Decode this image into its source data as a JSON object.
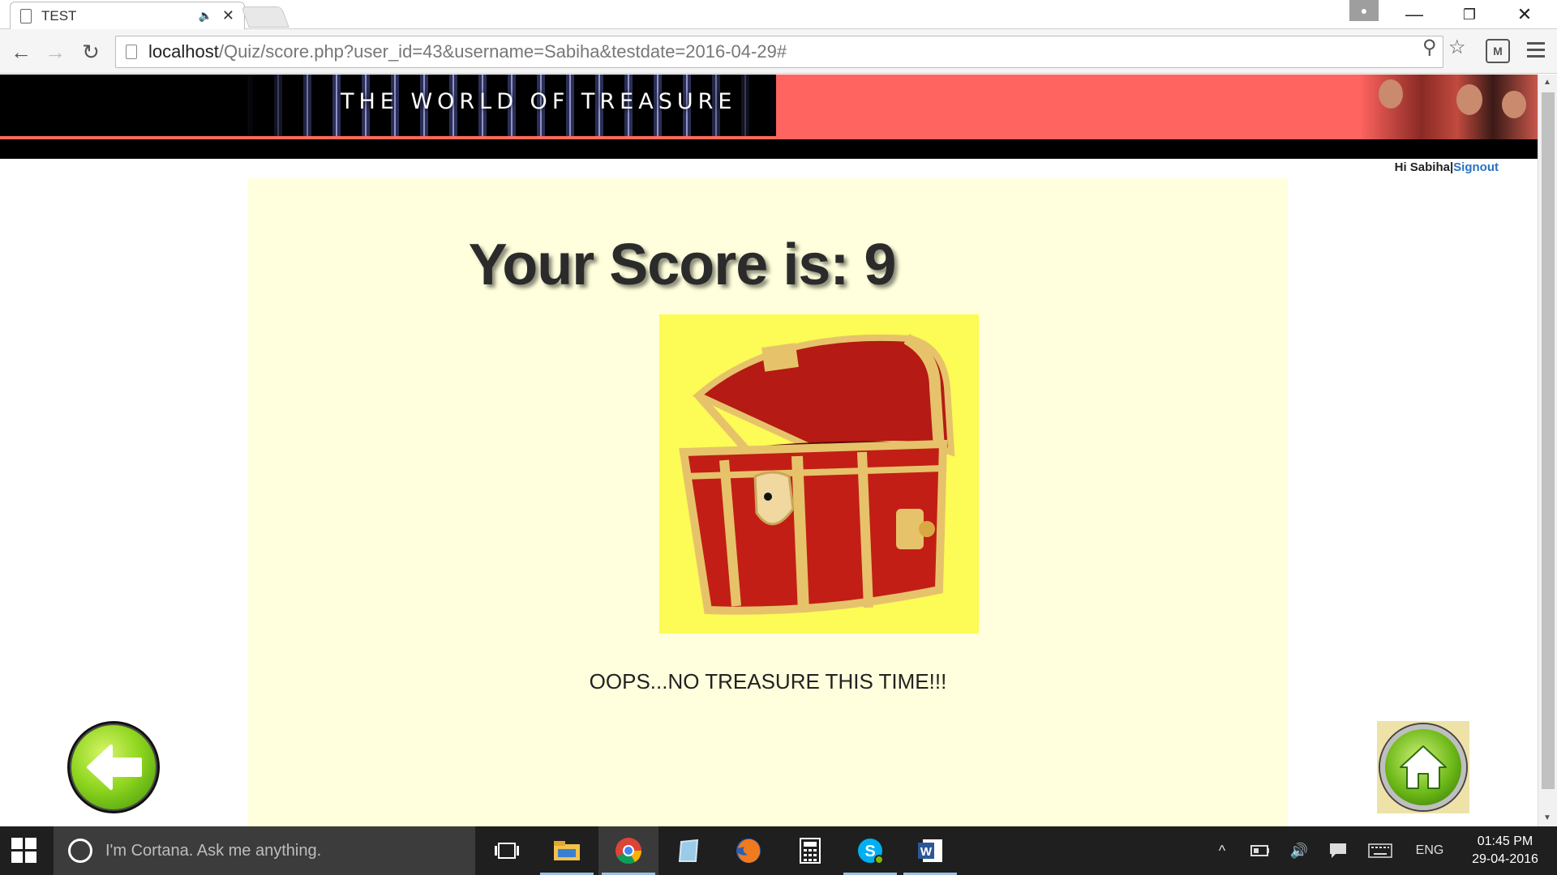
{
  "browser": {
    "tab_title": "TEST",
    "url_host": "localhost",
    "url_path": "/Quiz/score.php?user_id=43&username=Sabiha&testdate=2016-04-29#"
  },
  "page": {
    "banner_title": "THE WORLD OF TREASURE",
    "greeting": "Hi Sabiha",
    "separator": "|",
    "signout_label": "Signout",
    "score_text": "Your Score is: 9",
    "message": "OOPS...NO TREASURE THIS TIME!!!"
  },
  "taskbar": {
    "cortana_placeholder": "I'm Cortana. Ask me anything.",
    "language": "ENG",
    "time": "01:45 PM",
    "date": "29-04-2016"
  },
  "colors": {
    "card_bg": "#ffffdd",
    "chest_bg": "#fdfb55",
    "banner_salmon": "#ff6460",
    "link": "#2b72c2"
  }
}
